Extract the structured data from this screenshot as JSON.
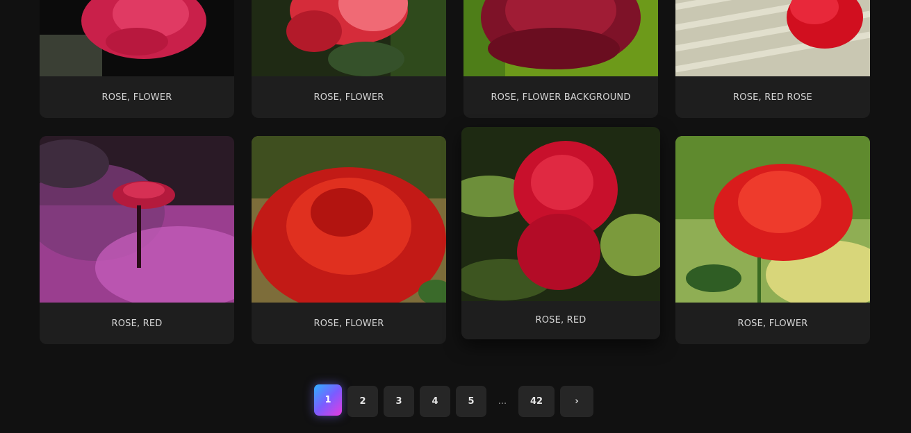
{
  "colors": {
    "background": "#111111",
    "card": "#1e1e1e",
    "caption_text": "#d6d6d6",
    "pager_button": "#262626",
    "active_gradient": [
      "#2fb0ff",
      "#7b5cff",
      "#e53be0"
    ]
  },
  "gallery": {
    "cards": [
      {
        "caption": "ROSE, FLOWER",
        "image": "red-rose-dark-background-photo"
      },
      {
        "caption": "ROSE, FLOWER",
        "image": "red-rose-bud-leaves-photo"
      },
      {
        "caption": "ROSE, FLOWER BACKGROUND",
        "image": "dark-red-rose-dew-green-background-photo"
      },
      {
        "caption": "ROSE, RED ROSE",
        "image": "red-rose-on-wicker-photo"
      },
      {
        "caption": "ROSE, RED",
        "image": "rose-in-purple-smoke-photo"
      },
      {
        "caption": "ROSE, FLOWER",
        "image": "large-red-rose-closeup-photo"
      },
      {
        "caption": "ROSE, RED",
        "image": "red-rose-with-raindrops-photo"
      },
      {
        "caption": "ROSE, FLOWER",
        "image": "red-rose-on-stem-garden-photo"
      }
    ]
  },
  "pagination": {
    "pages": [
      "1",
      "2",
      "3",
      "4",
      "5"
    ],
    "ellipsis": "...",
    "last_page": "42",
    "next_label": "›",
    "current_page": "1"
  }
}
